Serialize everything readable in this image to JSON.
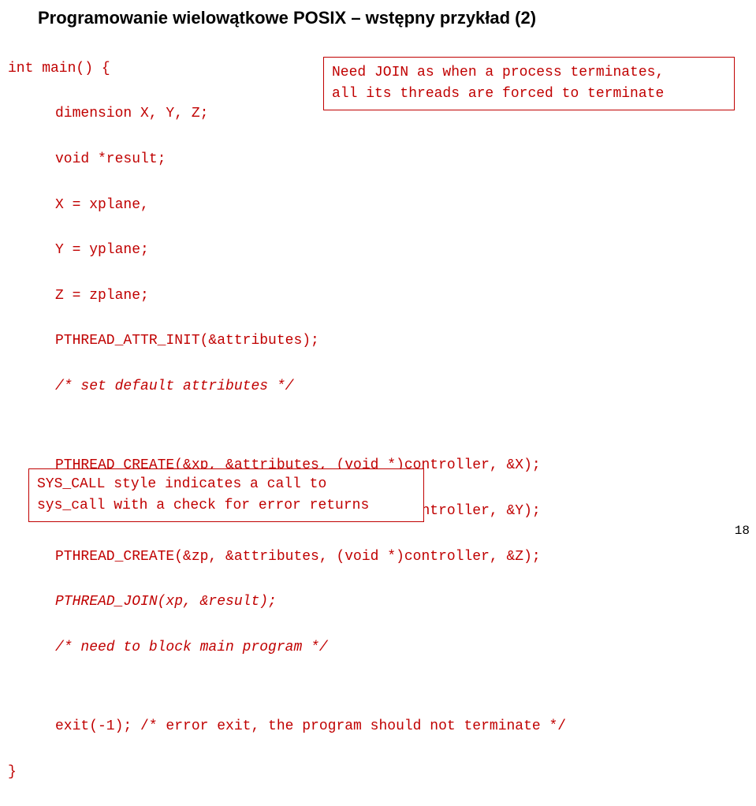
{
  "title": "Programowanie wielowątkowe POSIX – wstępny przykład (2)",
  "code": {
    "l1": "int main() {",
    "l2": "dimension X, Y, Z;",
    "l3": "void *result;",
    "l4": "X = xplane,",
    "l5": "Y = yplane;",
    "l6": "Z = zplane;",
    "l7": "PTHREAD_ATTR_INIT(&attributes);",
    "l8": "/* set default attributes */",
    "l9": "PTHREAD_CREATE(&xp, &attributes, (void *)controller, &X);",
    "l10": "PTHREAD_CREATE(&yp, &attributes, (void *)controller, &Y);",
    "l11": "PTHREAD_CREATE(&zp, &attributes, (void *)controller, &Z);",
    "l12": "PTHREAD_JOIN(xp, &result);",
    "l13": "/* need to block main program */",
    "l14": "exit(-1); /* error exit, the program should not terminate */",
    "l15": "}"
  },
  "callout1": {
    "line1": "Need JOIN as when a process terminates,",
    "line2": "all its threads are forced to terminate"
  },
  "callout2": {
    "line1": "SYS_CALL style indicates a call to",
    "line2": "sys_call with a check for error returns"
  },
  "page_number": "18"
}
